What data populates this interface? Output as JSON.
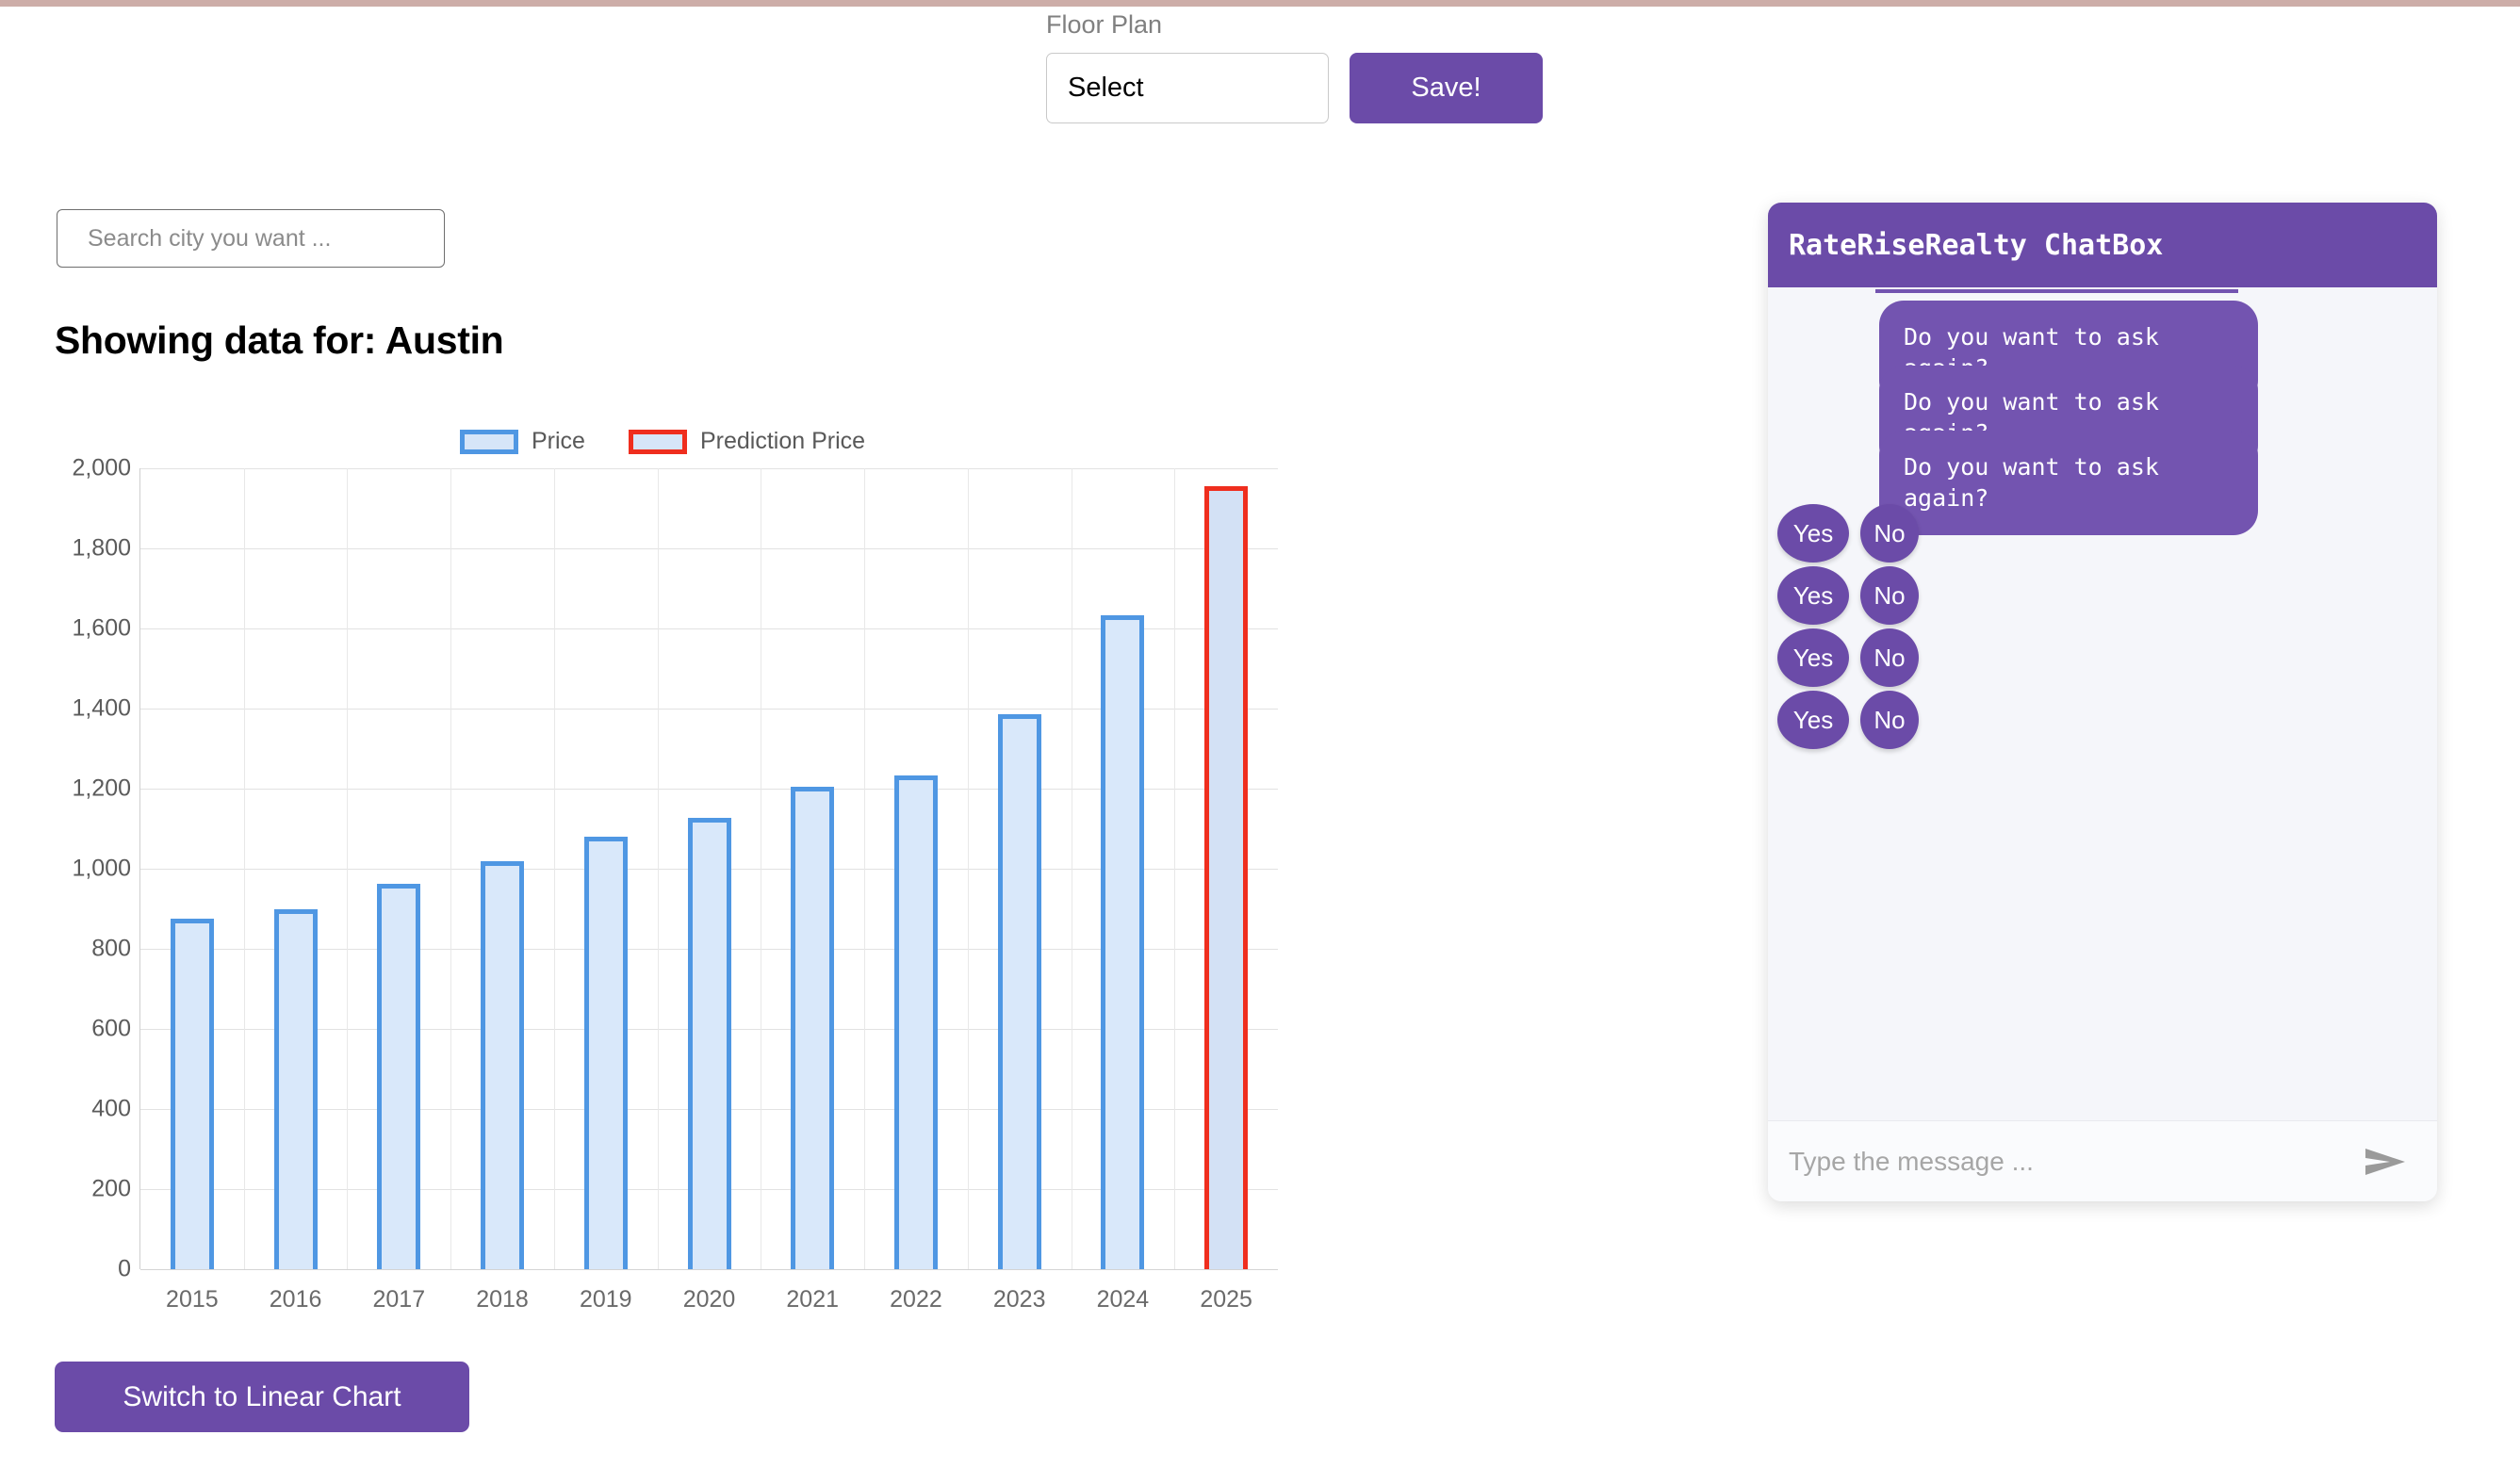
{
  "theme": {
    "top_strip_color": "#cdada8",
    "accent_purple": "#6b4ba8",
    "bubble_purple": "#7354b0",
    "bar_fill": "#d9e8fa",
    "bar_border": "#4f97e3",
    "prediction_border": "#ef2e1e",
    "chat_bg": "#f5f6fa"
  },
  "floorplan": {
    "label": "Floor Plan",
    "select_value": "Select",
    "save_label": "Save!"
  },
  "search": {
    "placeholder": "Search city you want ...",
    "value": ""
  },
  "main": {
    "title": "Showing data for: Austin",
    "switch_chart_label": "Switch to Linear Chart"
  },
  "chart_data": {
    "type": "bar",
    "title": "",
    "xlabel": "",
    "ylabel": "",
    "ylim": [
      0,
      2000
    ],
    "yticks": [
      "2,000",
      "1,800",
      "1,600",
      "1,400",
      "1,200",
      "1,000",
      "800",
      "600",
      "400",
      "200",
      "0"
    ],
    "ytick_values": [
      2000,
      1800,
      1600,
      1400,
      1200,
      1000,
      800,
      600,
      400,
      200,
      0
    ],
    "grid": true,
    "legend_position": "top",
    "legend": [
      {
        "label": "Price",
        "border_color": "#4f97e3",
        "fill_color": "#d6e5f8"
      },
      {
        "label": "Prediction Price",
        "border_color": "#ef2e1e",
        "fill_color": "#d6e5f8"
      }
    ],
    "categories": [
      "2015",
      "2016",
      "2017",
      "2018",
      "2019",
      "2020",
      "2021",
      "2022",
      "2023",
      "2024",
      "2025"
    ],
    "values": [
      875,
      900,
      963,
      1020,
      1080,
      1128,
      1205,
      1232,
      1385,
      1632,
      1955
    ],
    "series": [
      {
        "name": "Price",
        "categories": [
          "2015",
          "2016",
          "2017",
          "2018",
          "2019",
          "2020",
          "2021",
          "2022",
          "2023",
          "2024"
        ],
        "values": [
          875,
          900,
          963,
          1020,
          1080,
          1128,
          1205,
          1232,
          1385,
          1632
        ]
      },
      {
        "name": "Prediction Price",
        "categories": [
          "2025"
        ],
        "values": [
          1955
        ]
      }
    ]
  },
  "chat": {
    "title": "RateRiseRealty ChatBox",
    "messages": [
      {
        "sender": "bot",
        "text": "Do you want to ask again?"
      },
      {
        "sender": "bot",
        "text": "Do you want to ask again?"
      },
      {
        "sender": "bot",
        "text": "Do you want to ask again?"
      }
    ],
    "choice_rows": [
      {
        "yes": "Yes",
        "no": "No"
      },
      {
        "yes": "Yes",
        "no": "No"
      },
      {
        "yes": "Yes",
        "no": "No"
      },
      {
        "yes": "Yes",
        "no": "No"
      }
    ],
    "input_placeholder": "Type the message ...",
    "input_value": "",
    "send_icon": "send-icon"
  }
}
